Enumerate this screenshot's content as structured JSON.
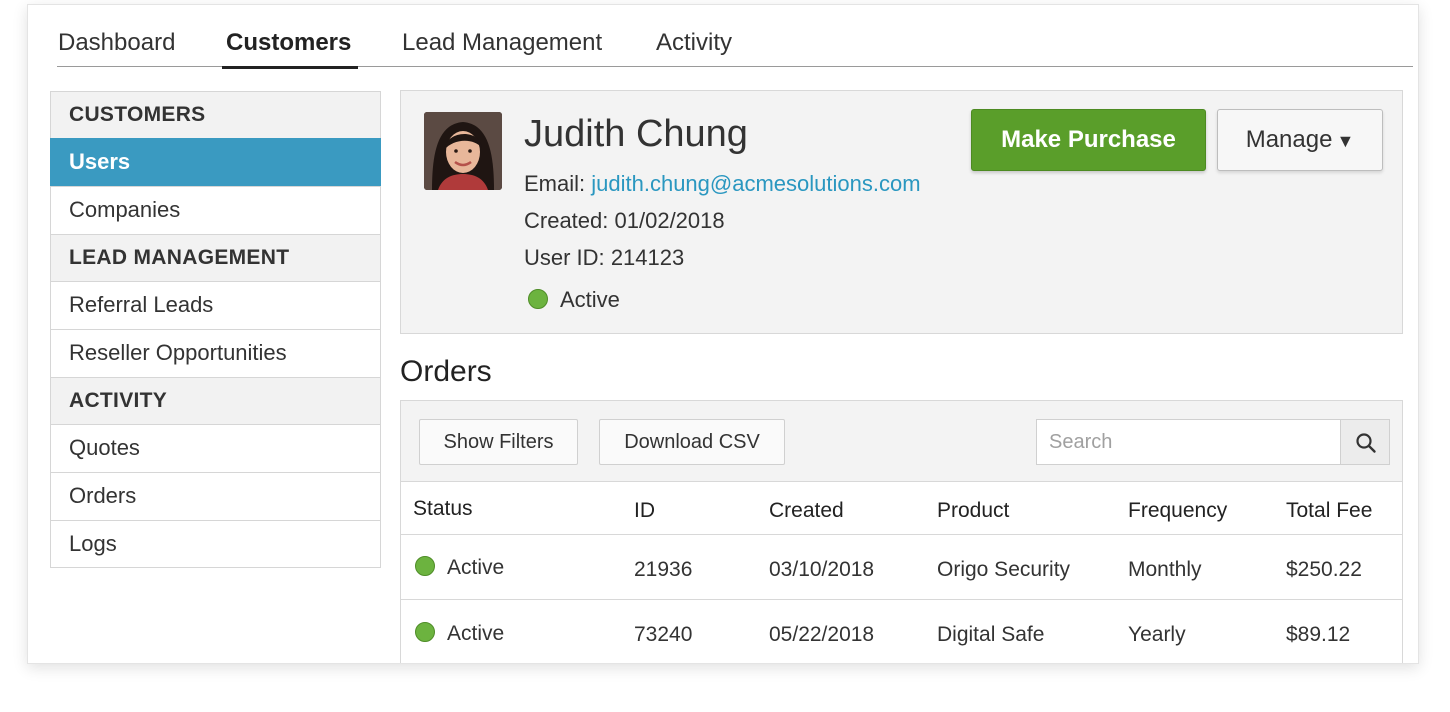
{
  "top_nav": {
    "tabs": [
      {
        "label": "Dashboard"
      },
      {
        "label": "Customers"
      },
      {
        "label": "Lead Management"
      },
      {
        "label": "Activity"
      }
    ]
  },
  "sidebar": {
    "sections": [
      {
        "heading": "CUSTOMERS",
        "items": [
          "Users",
          "Companies"
        ]
      },
      {
        "heading": "LEAD MANAGEMENT",
        "items": [
          "Referral Leads",
          "Reseller Opportunities"
        ]
      },
      {
        "heading": "ACTIVITY",
        "items": [
          "Quotes",
          "Orders",
          "Logs"
        ]
      }
    ],
    "active_item": "Users"
  },
  "profile": {
    "name": "Judith Chung",
    "email_label": "Email:",
    "email": "judith.chung@acmesolutions.com",
    "created_label": "Created:",
    "created": "01/02/2018",
    "user_id_label": "User ID:",
    "user_id": "214123",
    "status": "Active",
    "purchase_button": "Make Purchase",
    "manage_button": "Manage",
    "manage_caret": "▼"
  },
  "orders": {
    "title": "Orders",
    "show_filters": "Show Filters",
    "download_csv": "Download CSV",
    "search_placeholder": "Search",
    "columns": [
      "Status",
      "ID",
      "Created",
      "Product",
      "Frequency",
      "Total Fee"
    ],
    "rows": [
      {
        "status": "Active",
        "id": "21936",
        "created": "03/10/2018",
        "product": "Origo Security",
        "frequency": "Monthly",
        "total_fee": "$250.22"
      },
      {
        "status": "Active",
        "id": "73240",
        "created": "05/22/2018",
        "product": "Digital Safe",
        "frequency": "Yearly",
        "total_fee": "$89.12"
      }
    ]
  },
  "colors": {
    "accent_blue": "#3a9ac1",
    "link_blue": "#2a97c0",
    "purchase_green": "#5a9e2a",
    "status_green": "#6cb33f"
  },
  "icons": {
    "search": "search-icon",
    "status": "status-dot-icon",
    "avatar": "avatar"
  }
}
